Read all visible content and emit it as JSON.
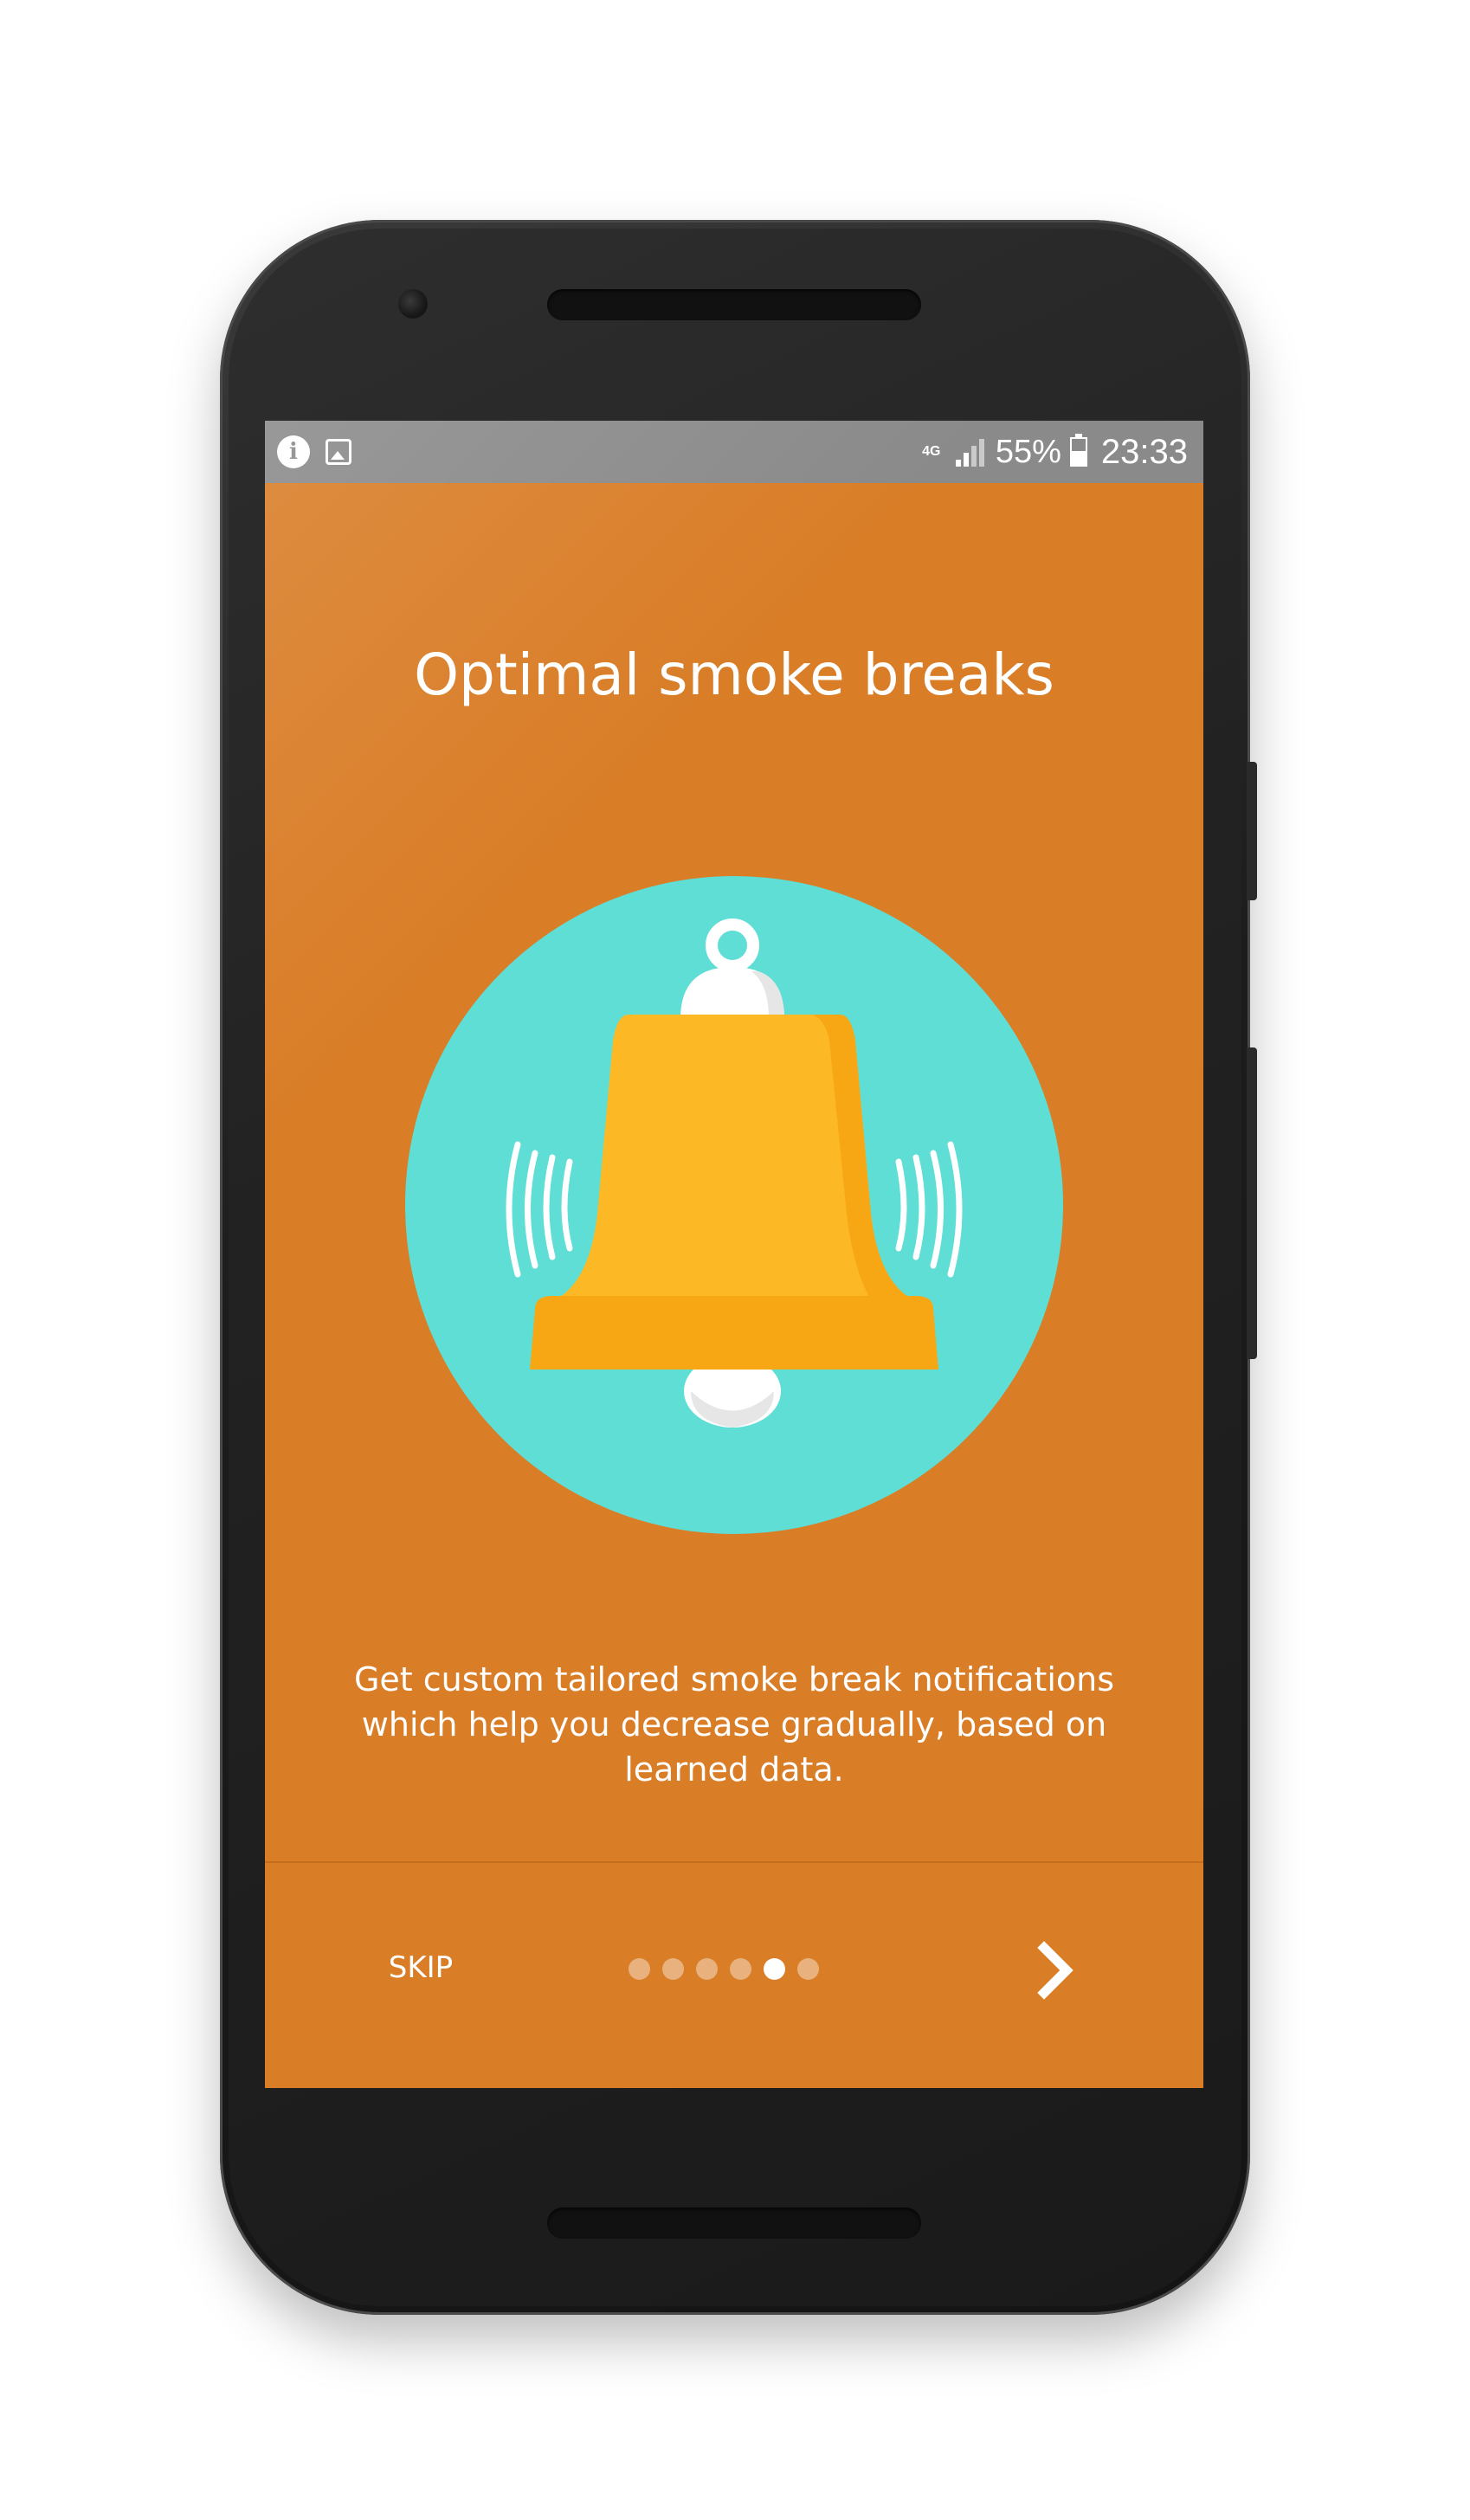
{
  "status_bar": {
    "network_type": "4G",
    "battery_percent": "55%",
    "battery_level": 0.55,
    "time": "23:33",
    "left_icons": [
      "info-icon",
      "image-icon"
    ],
    "right_icons": [
      "signal-icon",
      "battery-icon"
    ]
  },
  "onboarding": {
    "title": "Optimal smoke breaks",
    "illustration": "bell-icon",
    "description": "Get custom tailored smoke break notifications which help you decrease gradually, based on learned data.",
    "total_pages": 6,
    "current_page": 5
  },
  "navigation": {
    "skip_label": "SKIP",
    "next_icon": "chevron-right-icon"
  },
  "colors": {
    "background": "#d97d27",
    "circle": "#5fded5",
    "bell": "#fcb825",
    "bell_shadow": "#f8a714",
    "status_bar": "#8a8a8a",
    "text": "#ffffff"
  }
}
